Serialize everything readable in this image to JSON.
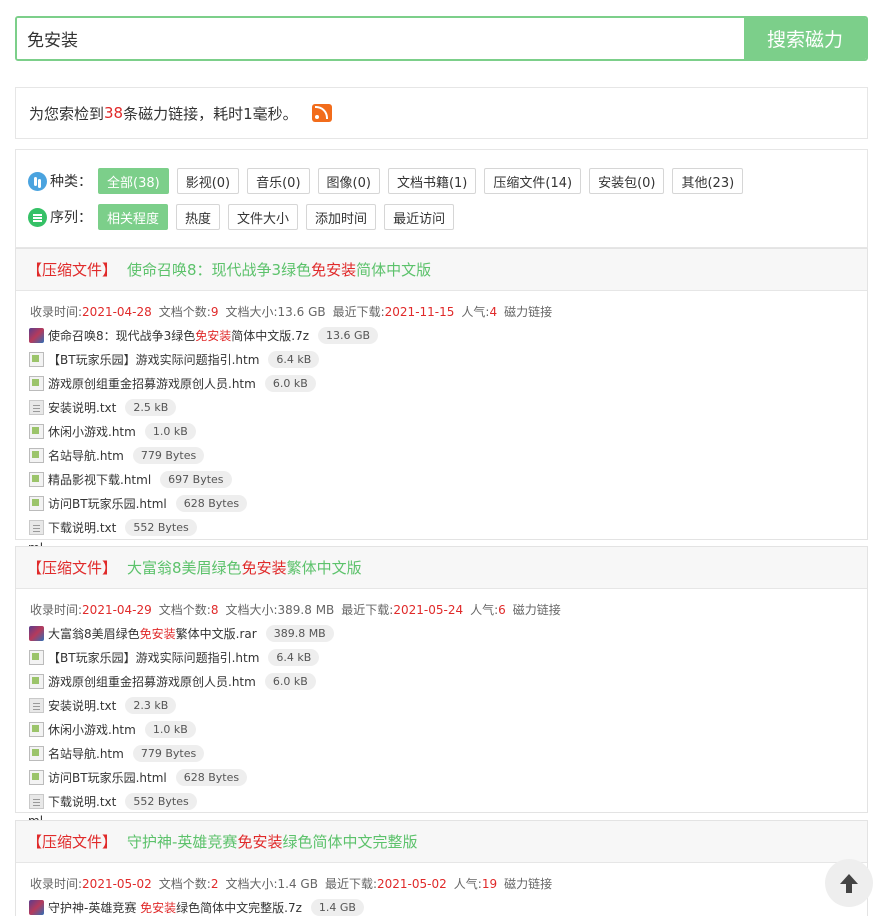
{
  "search": {
    "value": "免安装",
    "button": "搜索磁力"
  },
  "summary": {
    "prefix": "为您索检到",
    "count": "38",
    "suffix": "条磁力链接，耗时1毫秒。"
  },
  "filters": {
    "category_label": "种类：",
    "categories": [
      "全部(38)",
      "影视(0)",
      "音乐(0)",
      "图像(0)",
      "文档书籍(1)",
      "压缩文件(14)",
      "安装包(0)",
      "其他(23)"
    ],
    "sort_label": "序列：",
    "sorts": [
      "相关程度",
      "热度",
      "文件大小",
      "添加时间",
      "最近访问"
    ]
  },
  "results": [
    {
      "category": "【压缩文件】",
      "title_pre": "使命召唤8：现代战争3绿色",
      "title_hl": "免安装",
      "title_post": "简体中文版",
      "meta": {
        "added_label": "收录时间:",
        "added": "2021-04-28",
        "count_label": "文档个数:",
        "count": "9",
        "size_label": "文档大小:",
        "size": "13.6 GB",
        "last_label": "最近下载:",
        "last": "2021-11-15",
        "pop_label": "人气:",
        "pop": "4",
        "magnet": "磁力链接"
      },
      "files": [
        {
          "icon": "archive",
          "pre": "使命召唤8：现代战争3绿色",
          "hl": "免安装",
          "post": "简体中文版.7z",
          "size": "13.6 GB"
        },
        {
          "icon": "broken",
          "pre": "【BT玩家乐园】游戏实际问题指引.htm",
          "hl": "",
          "post": "",
          "size": "6.4 kB"
        },
        {
          "icon": "broken",
          "pre": "游戏原创组重金招募游戏原创人员.htm",
          "hl": "",
          "post": "",
          "size": "6.0 kB"
        },
        {
          "icon": "txt",
          "pre": "安装说明.txt",
          "hl": "",
          "post": "",
          "size": "2.5 kB"
        },
        {
          "icon": "broken",
          "pre": "休闲小游戏.htm",
          "hl": "",
          "post": "",
          "size": "1.0 kB"
        },
        {
          "icon": "broken",
          "pre": "名站导航.htm",
          "hl": "",
          "post": "",
          "size": "779 Bytes"
        },
        {
          "icon": "broken",
          "pre": "精品影视下载.html",
          "hl": "",
          "post": "",
          "size": "697 Bytes"
        },
        {
          "icon": "broken",
          "pre": "访问BT玩家乐园.html",
          "hl": "",
          "post": "",
          "size": "628 Bytes"
        },
        {
          "icon": "txt",
          "pre": "下载说明.txt",
          "hl": "",
          "post": "",
          "size": "552 Bytes"
        }
      ],
      "overflow": "ml"
    },
    {
      "category": "【压缩文件】",
      "title_pre": "大富翁8美眉绿色",
      "title_hl": "免安装",
      "title_post": "繁体中文版",
      "meta": {
        "added_label": "收录时间:",
        "added": "2021-04-29",
        "count_label": "文档个数:",
        "count": "8",
        "size_label": "文档大小:",
        "size": "389.8 MB",
        "last_label": "最近下载:",
        "last": "2021-05-24",
        "pop_label": "人气:",
        "pop": "6",
        "magnet": "磁力链接"
      },
      "files": [
        {
          "icon": "archive",
          "pre": "大富翁8美眉绿色",
          "hl": "免安装",
          "post": "繁体中文版.rar",
          "size": "389.8 MB"
        },
        {
          "icon": "broken",
          "pre": "【BT玩家乐园】游戏实际问题指引.htm",
          "hl": "",
          "post": "",
          "size": "6.4 kB"
        },
        {
          "icon": "broken",
          "pre": "游戏原创组重金招募游戏原创人员.htm",
          "hl": "",
          "post": "",
          "size": "6.0 kB"
        },
        {
          "icon": "txt",
          "pre": "安装说明.txt",
          "hl": "",
          "post": "",
          "size": "2.3 kB"
        },
        {
          "icon": "broken",
          "pre": "休闲小游戏.htm",
          "hl": "",
          "post": "",
          "size": "1.0 kB"
        },
        {
          "icon": "broken",
          "pre": "名站导航.htm",
          "hl": "",
          "post": "",
          "size": "779 Bytes"
        },
        {
          "icon": "broken",
          "pre": "访问BT玩家乐园.html",
          "hl": "",
          "post": "",
          "size": "628 Bytes"
        },
        {
          "icon": "txt",
          "pre": "下载说明.txt",
          "hl": "",
          "post": "",
          "size": "552 Bytes"
        }
      ],
      "overflow": "ml"
    },
    {
      "category": "【压缩文件】",
      "title_pre": "守护神-英雄竞赛 ",
      "title_hl": "免安装",
      "title_post": "绿色简体中文完整版",
      "meta": {
        "added_label": "收录时间:",
        "added": "2021-05-02",
        "count_label": "文档个数:",
        "count": "2",
        "size_label": "文档大小:",
        "size": "1.4 GB",
        "last_label": "最近下载:",
        "last": "2021-05-02",
        "pop_label": "人气:",
        "pop": "19",
        "magnet": "磁力链接"
      },
      "files": [
        {
          "icon": "archive",
          "pre": "守护神-英雄竞赛 ",
          "hl": "免安装",
          "post": "绿色简体中文完整版.7z",
          "size": "1.4 GB"
        }
      ],
      "overflow": ""
    }
  ],
  "colors": {
    "accent": "#7ccf8a",
    "highlight": "#e02a2a"
  }
}
